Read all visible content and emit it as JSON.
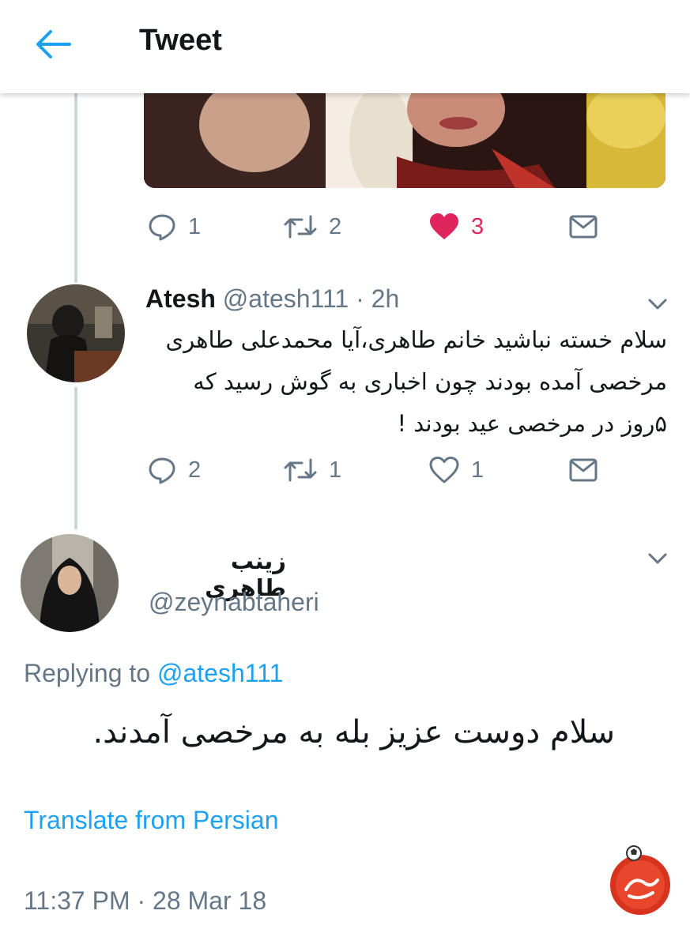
{
  "header": {
    "title": "Tweet",
    "back_icon": "arrow-left-icon",
    "accent": "#1da1f2"
  },
  "tweet1": {
    "image_alt": "photo",
    "actions": {
      "reply_count": "1",
      "retweet_count": "2",
      "like_count": "3",
      "liked": true
    }
  },
  "tweet2": {
    "name": "Atesh",
    "handle": "@atesh111",
    "separator": "·",
    "time": "2h",
    "text": "سلام خسته نباشید خانم طاهری،آیا محمدعلی طاهری مرخصی آمده بودند چون اخباری به گوش رسید که ۵روز در مرخصی عید بودند !",
    "actions": {
      "reply_count": "2",
      "retweet_count": "1",
      "like_count": "1"
    }
  },
  "tweet3": {
    "name": "زینب طاهری",
    "handle": "@zeynabtaheri",
    "replying_prefix": "Replying to ",
    "replying_to": "@atesh111",
    "text": "سلام دوست عزیز بله به مرخصی آمدند.",
    "translate": "Translate from Persian",
    "timestamp": "11:37 PM · 28 Mar 18"
  },
  "colors": {
    "text_primary": "#14171a",
    "text_secondary": "#657786",
    "link": "#1da1f2",
    "like": "#e0245e",
    "thread_line": "#ccd6dd"
  }
}
